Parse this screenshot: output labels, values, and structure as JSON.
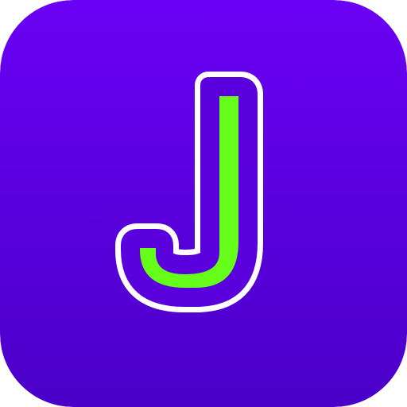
{
  "app_icon": {
    "glyph": "J",
    "glyph_description": "letter-j-icon",
    "colors": {
      "background_top": "#6a00f4",
      "background_bottom": "#4a00c8",
      "glyph_fill": "#66ff1a",
      "glyph_inner_outline": "#5a00dc",
      "glyph_outer_outline": "#ffffff"
    }
  }
}
